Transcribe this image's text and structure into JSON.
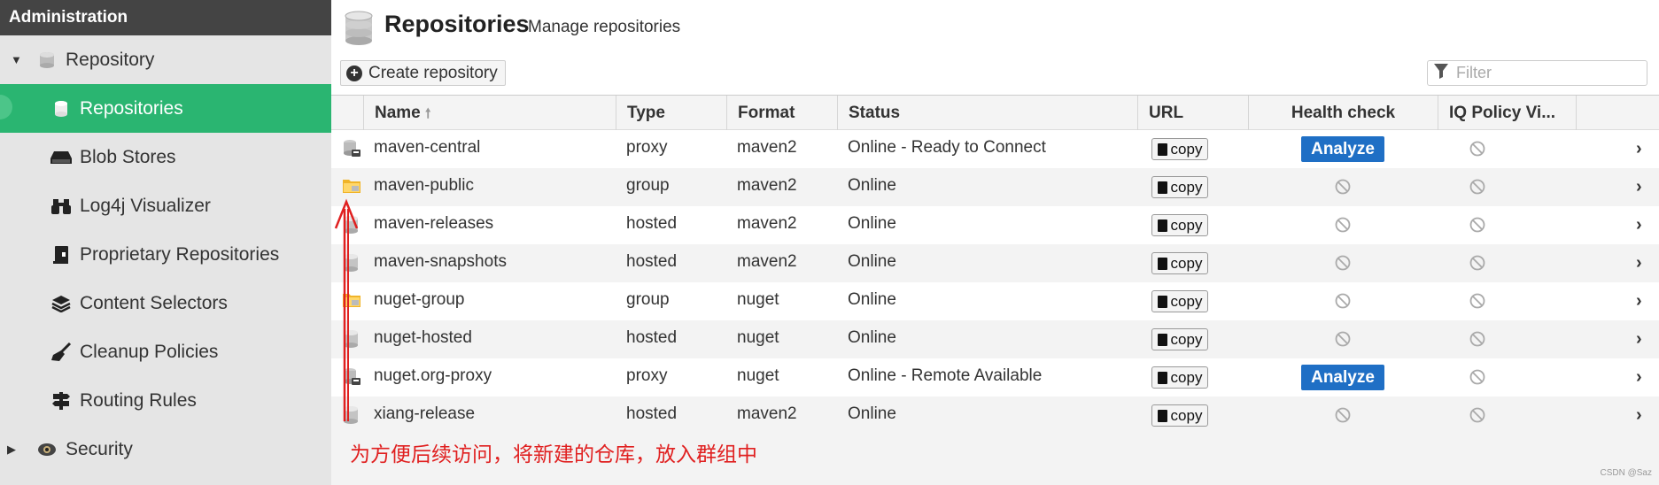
{
  "sidebar": {
    "header": "Administration",
    "repository_group": "Repository",
    "items": [
      {
        "label": "Repositories",
        "icon": "database-icon",
        "active": true
      },
      {
        "label": "Blob Stores",
        "icon": "hdd-icon"
      },
      {
        "label": "Log4j Visualizer",
        "icon": "binoculars-icon"
      },
      {
        "label": "Proprietary Repositories",
        "icon": "book-icon"
      },
      {
        "label": "Content Selectors",
        "icon": "layers-icon"
      },
      {
        "label": "Cleanup Policies",
        "icon": "broom-icon"
      },
      {
        "label": "Routing Rules",
        "icon": "signpost-icon"
      }
    ],
    "security_group": "Security"
  },
  "header": {
    "title": "Repositories",
    "subtitle": "Manage repositories",
    "create_label": "Create repository",
    "filter_placeholder": "Filter"
  },
  "columns": {
    "name": "Name",
    "type": "Type",
    "format": "Format",
    "status": "Status",
    "url": "URL",
    "health": "Health check",
    "iq": "IQ Policy Vi..."
  },
  "copy_label": "copy",
  "analyze_label": "Analyze",
  "rows": [
    {
      "name": "maven-central",
      "type": "proxy",
      "format": "maven2",
      "status": "Online - Ready to Connect",
      "health": "analyze"
    },
    {
      "name": "maven-public",
      "type": "group",
      "format": "maven2",
      "status": "Online",
      "health": "disabled"
    },
    {
      "name": "maven-releases",
      "type": "hosted",
      "format": "maven2",
      "status": "Online",
      "health": "disabled"
    },
    {
      "name": "maven-snapshots",
      "type": "hosted",
      "format": "maven2",
      "status": "Online",
      "health": "disabled"
    },
    {
      "name": "nuget-group",
      "type": "group",
      "format": "nuget",
      "status": "Online",
      "health": "disabled"
    },
    {
      "name": "nuget-hosted",
      "type": "hosted",
      "format": "nuget",
      "status": "Online",
      "health": "disabled"
    },
    {
      "name": "nuget.org-proxy",
      "type": "proxy",
      "format": "nuget",
      "status": "Online - Remote Available",
      "health": "analyze"
    },
    {
      "name": "xiang-release",
      "type": "hosted",
      "format": "maven2",
      "status": "Online",
      "health": "disabled"
    }
  ],
  "annotation": "为方便后续访问，将新建的仓库，放入群组中",
  "watermark": "CSDN @Saz",
  "colors": {
    "active": "#2ab571",
    "analyze": "#1f6fc5",
    "annotation": "#e02020",
    "sidebar_header": "#444444"
  }
}
